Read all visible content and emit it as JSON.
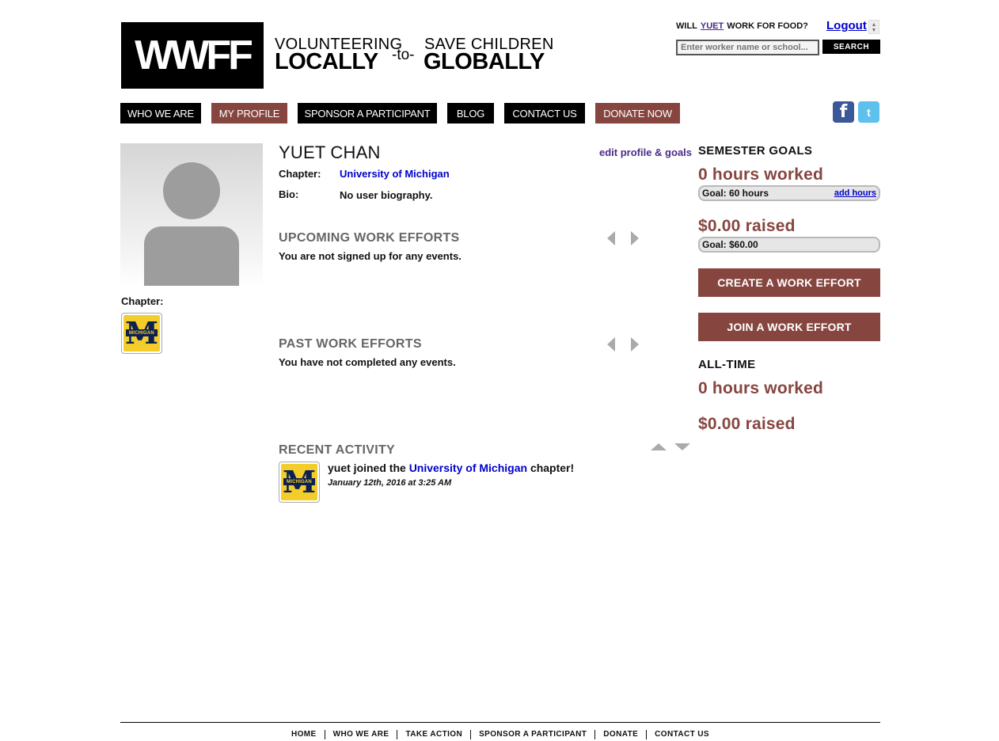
{
  "header": {
    "logo_text": "WWFF",
    "tagline_small_left": "VOLUNTEERING",
    "tagline_big_left": "LOCALLY",
    "tagline_connector": "-to-",
    "tagline_small_right": "SAVE CHILDREN",
    "tagline_big_right": "GLOBALLY",
    "will_prefix": "WILL",
    "will_name": "YUET",
    "will_suffix": "WORK FOR FOOD?",
    "logout_label": "Logout",
    "search_placeholder": "Enter worker name or school...",
    "search_button": "SEARCH"
  },
  "nav": {
    "items": [
      {
        "label": "WHO WE ARE"
      },
      {
        "label": "MY PROFILE"
      },
      {
        "label": "SPONSOR A PARTICIPANT"
      },
      {
        "label": "BLOG"
      },
      {
        "label": "CONTACT US"
      },
      {
        "label": "DONATE NOW"
      }
    ],
    "facebook_icon": "f",
    "twitter_icon": "t"
  },
  "profile": {
    "name": "YUET CHAN",
    "edit_link": "edit profile & goals",
    "chapter_label": "Chapter:",
    "chapter_value": "University of Michigan",
    "bio_label": "Bio:",
    "bio_value": "No user biography.",
    "left_chapter_label": "Chapter:",
    "badge_letter": "M",
    "badge_band": "MICHIGAN"
  },
  "upcoming": {
    "title": "UPCOMING WORK EFFORTS",
    "text": "You are not signed up for any events."
  },
  "past": {
    "title": "PAST WORK EFFORTS",
    "text": "You have not completed any events."
  },
  "activity": {
    "title": "RECENT ACTIVITY",
    "prefix": "yuet joined the",
    "link": "University of Michigan",
    "suffix": "chapter!",
    "date": "January 12th, 2016 at 3:25 AM"
  },
  "semester": {
    "title": "SEMESTER GOALS",
    "hours_worked": "0 hours worked",
    "hours_goal": "Goal: 60 hours",
    "add_hours": "add hours",
    "raised": "$0.00 raised",
    "raised_goal": "Goal: $60.00",
    "create_button": "CREATE A WORK EFFORT",
    "join_button": "JOIN A WORK EFFORT"
  },
  "alltime": {
    "title": "ALL-TIME",
    "hours_worked": "0 hours worked",
    "raised": "$0.00 raised"
  },
  "footer": {
    "links": [
      "HOME",
      "WHO WE ARE",
      "TAKE ACTION",
      "SPONSOR A PARTICIPANT",
      "DONATE",
      "CONTACT US"
    ]
  }
}
